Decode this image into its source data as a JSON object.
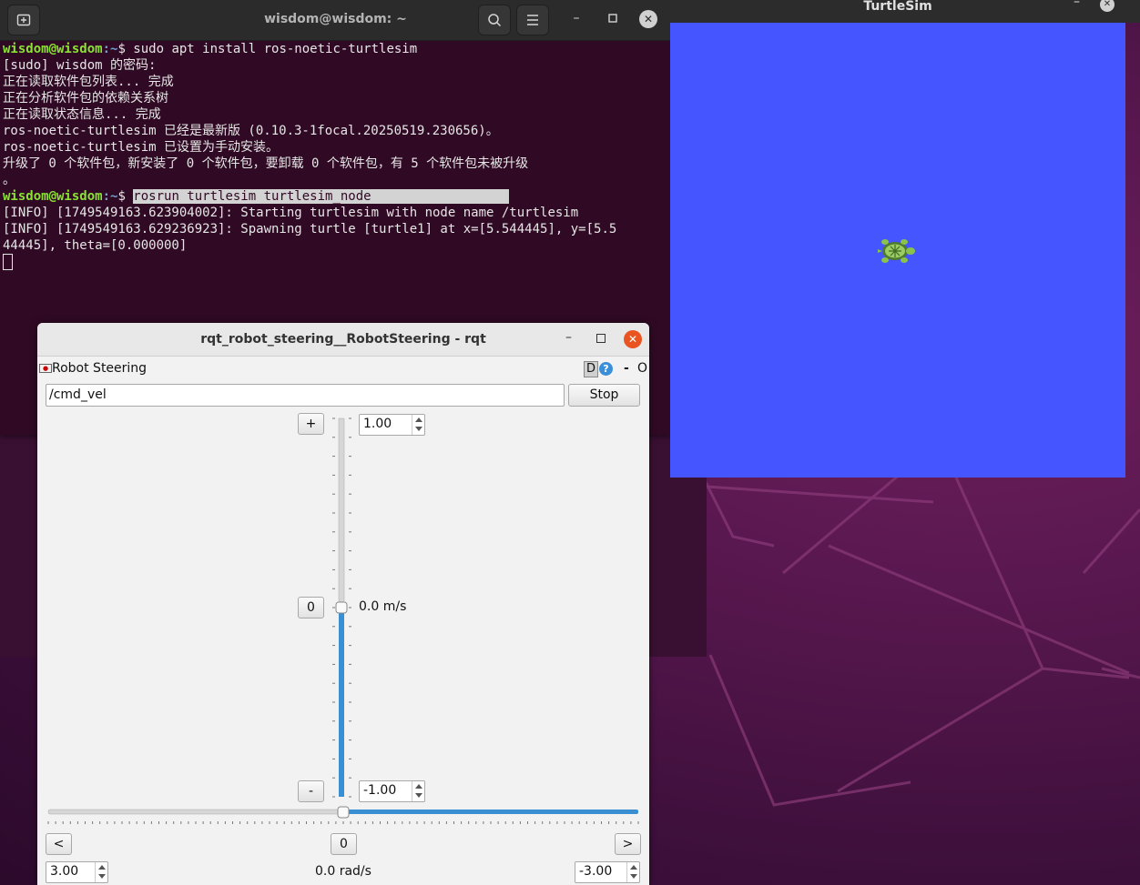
{
  "terminal": {
    "title": "wisdom@wisdom: ~",
    "lines": {
      "l1_user": "wisdom@wisdom",
      "l1_path": ":~",
      "l1_cmd": "$ sudo apt install ros-noetic-turtlesim",
      "l2": "[sudo] wisdom 的密码:",
      "l3": "正在读取软件包列表... 完成",
      "l4": "正在分析软件包的依赖关系树",
      "l5": "正在读取状态信息... 完成",
      "l6": "ros-noetic-turtlesim 已经是最新版 (0.10.3-1focal.20250519.230656)。",
      "l7": "ros-noetic-turtlesim 已设置为手动安装。",
      "l8": "升级了 0 个软件包，新安装了 0 个软件包，要卸载 0 个软件包，有 5 个软件包未被升级",
      "l9": "。",
      "l10_user": "wisdom@wisdom",
      "l10_path": ":~",
      "l10_dollar": "$ ",
      "l10_cmd": "rosrun turtlesim turtlesim_node",
      "l11": "[INFO] [1749549163.623904002]: Starting turtlesim with node name /turtlesim",
      "l12": "[INFO] [1749549163.629236923]: Spawning turtle [turtle1] at x=[5.544445], y=[5.5",
      "l13": "44445], theta=[0.000000]"
    }
  },
  "turtlesim": {
    "title": "TurtleSim",
    "canvas_color": "#4555ff"
  },
  "rqt": {
    "title": "rqt_robot_steering__RobotSteering - rqt",
    "plugin_title": "Robot Steering",
    "plugin_d": "D",
    "plugin_help": "?",
    "plugin_dash": "-",
    "plugin_o": "O",
    "topic": "/cmd_vel",
    "stop_label": "Stop",
    "linear": {
      "plus_label": "+",
      "zero_label": "0",
      "minus_label": "-",
      "max": "1.00",
      "min": "-1.00",
      "value_label": "0.0 m/s",
      "value": 0.0
    },
    "angular": {
      "left_label": "<",
      "zero_label": "0",
      "right_label": ">",
      "left_limit": "3.00",
      "right_limit": "-3.00",
      "value_label": "0.0 rad/s",
      "value": 0.0
    }
  }
}
